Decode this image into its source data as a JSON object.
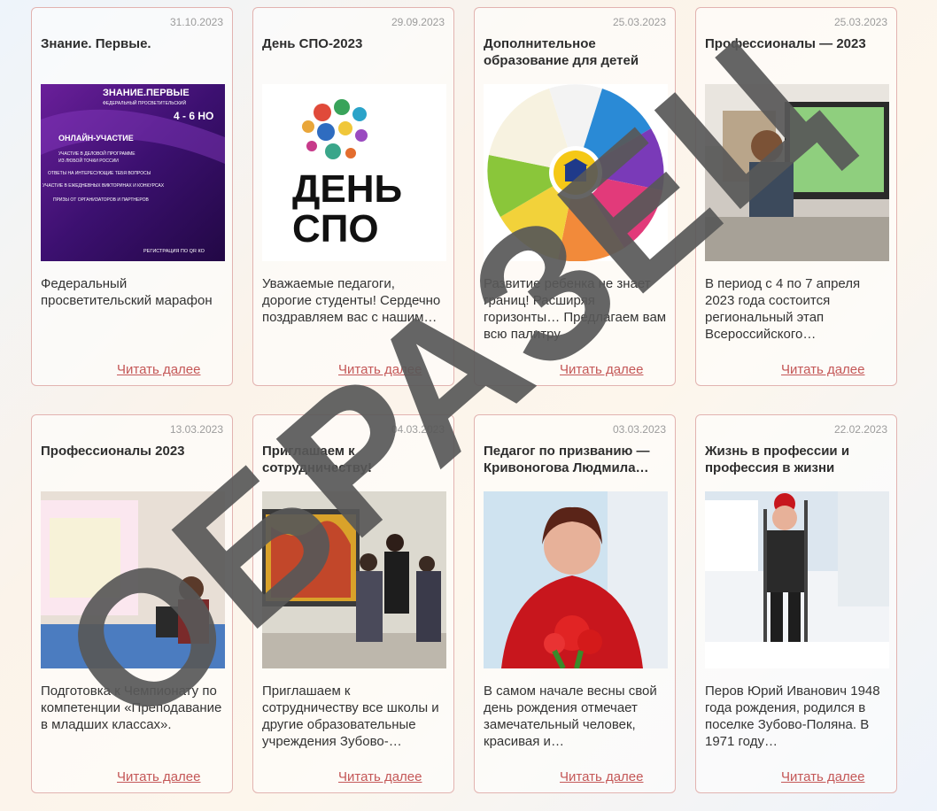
{
  "cards": [
    {
      "date": "31.10.2023",
      "title": "Знание. Первые.",
      "excerpt": "Федеральный просветительский марафон",
      "more": "Читать далее",
      "image_text": {
        "line1": "ЗНАНИЕ.ПЕРВЫЕ",
        "line2": "ФЕДЕРАЛЬНЫЙ ПРОСВЕТИТЕЛЬСКИЙ",
        "date_range": "4 - 6 НО",
        "online": "ОНЛАЙН-УЧАСТИЕ",
        "items": [
          "УЧАСТИЕ В ДЕЛОВОЙ ПРОГРАММЕ",
          "ИЗ ЛЮБОЙ ТОЧКИ РОССИИ",
          "ОТВЕТЫ НА ИНТЕРЕСУЮЩИЕ ТЕБЯ ВОПРОСЫ",
          "УЧАСТИЕ В ЕЖЕДНЕВНЫХ ВИКТОРИНАХ И КОНКУРСАХ",
          "ПРИЗЫ ОТ ОРГАНИЗАТОРОВ И ПАРТНЕРОВ"
        ],
        "footer": "РЕГИСТРАЦИЯ ПО QR КО"
      }
    },
    {
      "date": "29.09.2023",
      "title": "День СПО-2023",
      "excerpt": "Уважаемые педагоги, дорогие студенты! Сердечно поздравляем вас с нашим…",
      "more": "Читать далее",
      "image_text": {
        "line1": "ДЕНЬ",
        "line2": "СПО"
      }
    },
    {
      "date": "25.03.2023",
      "title": "Дополнительное образование для детей",
      "excerpt": "Развитие ребенка не знает границ! Расширяя горизонты… Предлагаем вам всю палитру образовательных…",
      "more": "Читать далее"
    },
    {
      "date": "25.03.2023",
      "title": "Профессионалы — 2023",
      "excerpt": "В период с 4 по 7 апреля 2023 года состоится региональный этап Всероссийского…",
      "more": "Читать далее"
    },
    {
      "date": "13.03.2023",
      "title": "Профессионалы 2023",
      "excerpt": "Подготовка к Чемпионату по компетенции «Преподавание в младших классах».",
      "more": "Читать далее"
    },
    {
      "date": "04.03.2023",
      "title": "Приглашаем к сотрудничеству!",
      "excerpt": "Приглашаем к сотрудничеству все школы и другие образовательные учреждения Зубово-…",
      "more": "Читать далее"
    },
    {
      "date": "03.03.2023",
      "title": "Педагог по призванию — Кривоногова Людмила…",
      "excerpt": "В самом начале весны свой день рождения отмечает замечательный человек, красивая и…",
      "more": "Читать далее"
    },
    {
      "date": "22.02.2023",
      "title": "Жизнь в профессии и профессия в жизни",
      "excerpt": "Перов Юрий Иванович 1948 года рождения, родился в поселке Зубово-Поляна. В 1971 году…",
      "more": "Читать далее"
    }
  ],
  "watermark": "ОБРАЗЕЦ"
}
